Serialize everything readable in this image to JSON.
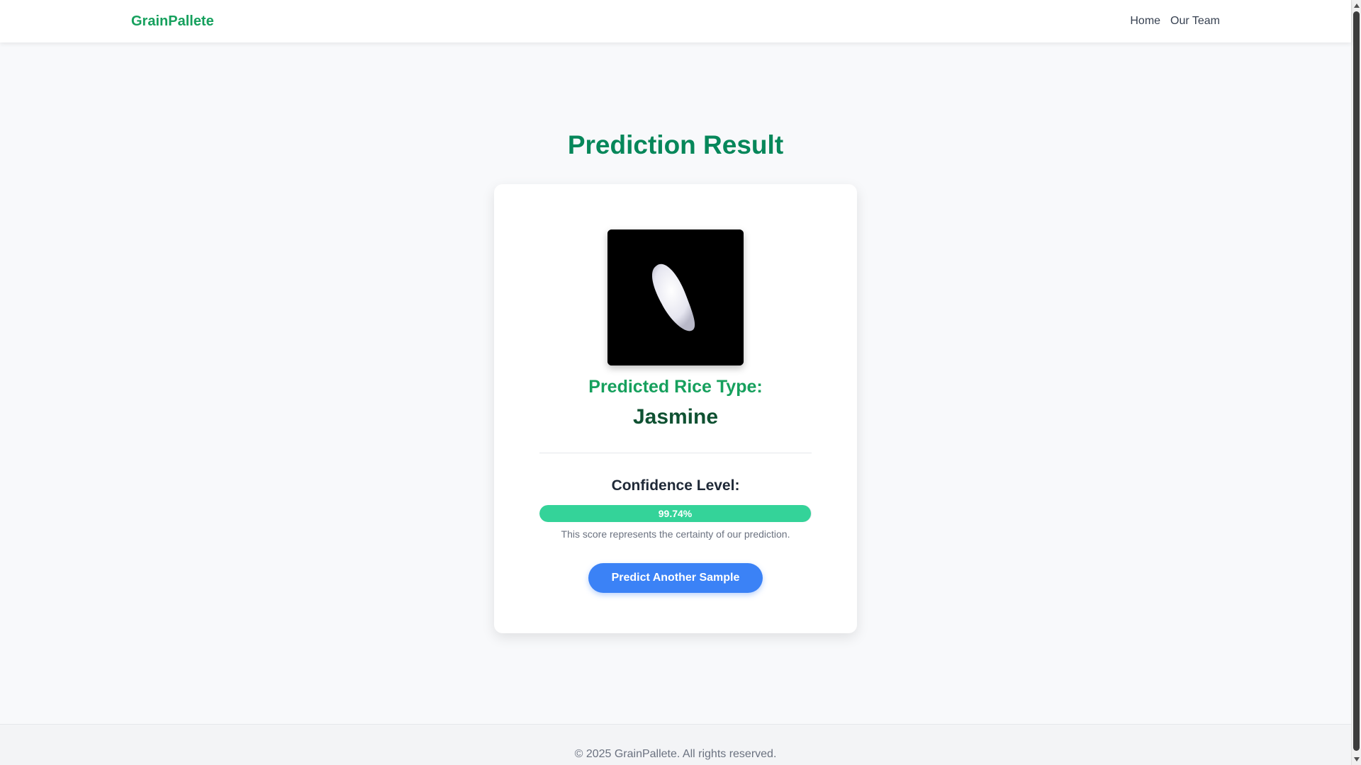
{
  "navbar": {
    "brand": "GrainPallete",
    "links": [
      "Home",
      "Our Team"
    ]
  },
  "main": {
    "title": "Prediction Result",
    "card": {
      "predicted_label": "Predicted Rice Type:",
      "predicted_value": "Jasmine",
      "confidence_label": "Confidence Level:",
      "confidence_percent": 99.74,
      "confidence_text": "99.74%",
      "confidence_note": "This score represents the certainty of our prediction.",
      "button_label": "Predict Another Sample"
    }
  },
  "footer": {
    "text": "© 2025 GrainPallete. All rights reserved."
  },
  "colors": {
    "brand_green": "#16a05d",
    "title_green": "#06875a",
    "value_green": "#0f5132",
    "progress_fill": "#34d399",
    "button_blue": "#3b82f6"
  }
}
